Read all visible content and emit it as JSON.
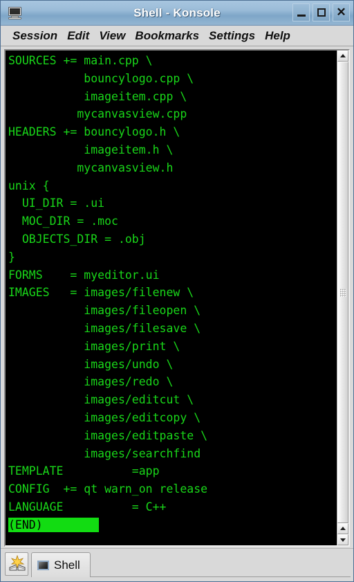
{
  "window": {
    "title": "Shell - Konsole",
    "icon": "monitor-icon",
    "buttons": {
      "minimize": "_",
      "maximize": "□",
      "close": "✕"
    }
  },
  "menubar": {
    "items": [
      {
        "label": "Session"
      },
      {
        "label": "Edit"
      },
      {
        "label": "View"
      },
      {
        "label": "Bookmarks"
      },
      {
        "label": "Settings"
      },
      {
        "label": "Help"
      }
    ]
  },
  "terminal": {
    "foreground": "#19d719",
    "background": "#000000",
    "highlight_bg": "#12dc12",
    "highlight_fg": "#000000",
    "lines": [
      "SOURCES += main.cpp \\",
      "           bouncylogo.cpp \\",
      "           imageitem.cpp \\",
      "          mycanvasview.cpp",
      "HEADERS += bouncylogo.h \\",
      "           imageitem.h \\",
      "          mycanvasview.h",
      "unix {",
      "  UI_DIR = .ui",
      "  MOC_DIR = .moc",
      "  OBJECTS_DIR = .obj",
      "}",
      "FORMS    = myeditor.ui",
      "IMAGES   = images/filenew \\",
      "           images/fileopen \\",
      "           images/filesave \\",
      "           images/print \\",
      "           images/undo \\",
      "           images/redo \\",
      "           images/editcut \\",
      "           images/editcopy \\",
      "           images/editpaste \\",
      "           images/searchfind",
      "TEMPLATE          =app",
      "CONFIG  += qt warn_on release",
      "LANGUAGE          = C++"
    ],
    "pager_marker": "(END)"
  },
  "scrollbar": {
    "up_arrow": "▲",
    "down_arrow": "▼"
  },
  "tabbar": {
    "new_session_button": "new-session",
    "tabs": [
      {
        "label": "Shell",
        "icon": "terminal-icon",
        "active": true
      }
    ]
  }
}
